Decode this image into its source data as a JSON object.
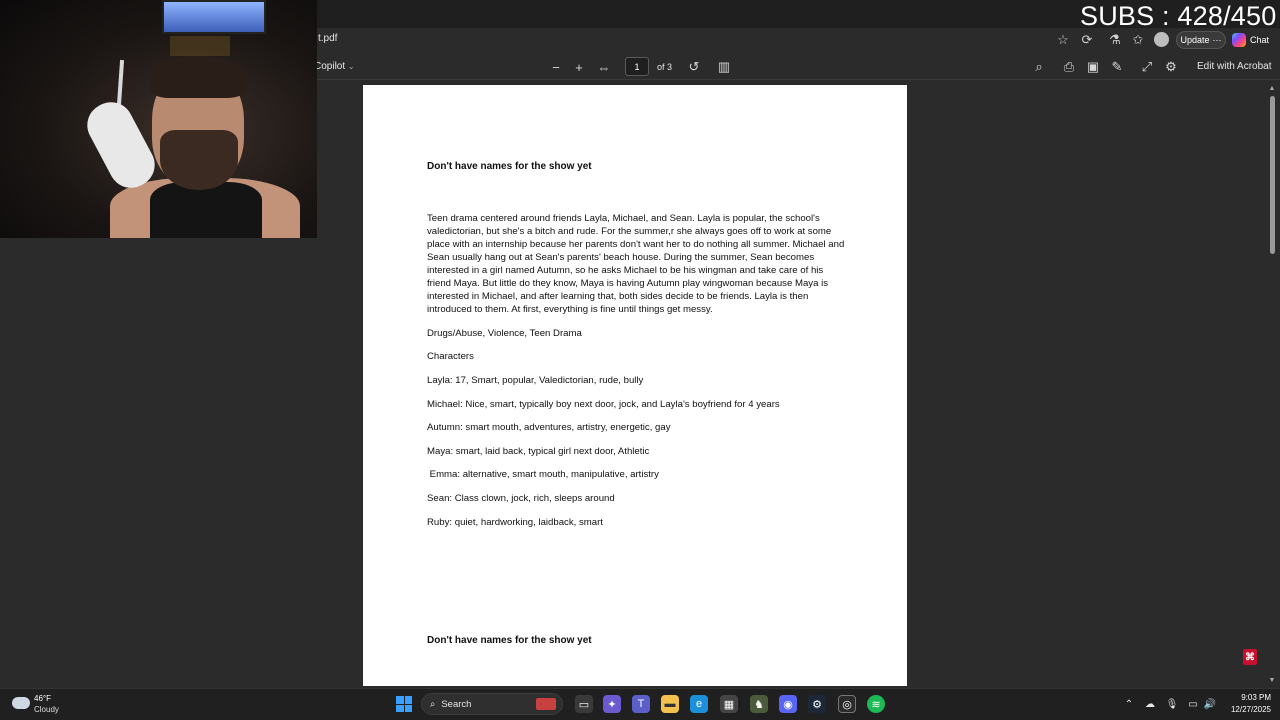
{
  "overlay": {
    "subs": "SUBS : 428/450"
  },
  "browser": {
    "url_text": "t.pdf",
    "update_label": "Update",
    "update_more": "⋯",
    "chat_label": "Chat"
  },
  "pdf_toolbar": {
    "copilot_label": "Copilot",
    "page_current": "1",
    "page_total": "of 3",
    "edit_label": "Edit with Acrobat"
  },
  "document": {
    "heading": "Don't have names for the show yet",
    "body": "Teen drama centered around friends Layla, Michael, and Sean. Layla is popular, the school's valedictorian, but she's a bitch and rude. For the summer,r she always goes off to work at some place with an internship because her parents don't want her to do nothing all summer. Michael and Sean usually hang out at Sean's parents' beach house. During the summer, Sean becomes interested in a girl named Autumn, so he asks Michael to be his wingman and take care of his friend Maya. But little do they know, Maya is having Autumn play wingwoman because Maya is interested in Michael, and after learning that, both sides decide to be friends. Layla is then introduced to them. At first, everything is fine until things get messy.",
    "genres": "Drugs/Abuse, Violence, Teen Drama",
    "characters_heading": "Characters",
    "characters": [
      "Layla: 17, Smart, popular, Valedictorian, rude, bully",
      "Michael: Nice, smart, typically boy next door, jock, and Layla's boyfriend for 4 years",
      "Autumn: smart mouth, adventures, artistry, energetic, gay",
      "Maya: smart, laid back, typical girl next door, Athletic",
      " Emma: alternative, smart mouth, manipulative, artistry",
      "Sean: Class clown, jock, rich, sleeps around",
      "Ruby: quiet, hardworking, laidback, smart"
    ],
    "heading_2": "Don't have names for the show yet"
  },
  "taskbar": {
    "weather_temp": "46°F",
    "weather_desc": "Cloudy",
    "search_label": "Search",
    "clock_time": "9:03 PM",
    "clock_date": "12/27/2025"
  },
  "colors": {
    "accent": "#3aa0ff",
    "acrobat_red": "#c8102e"
  }
}
